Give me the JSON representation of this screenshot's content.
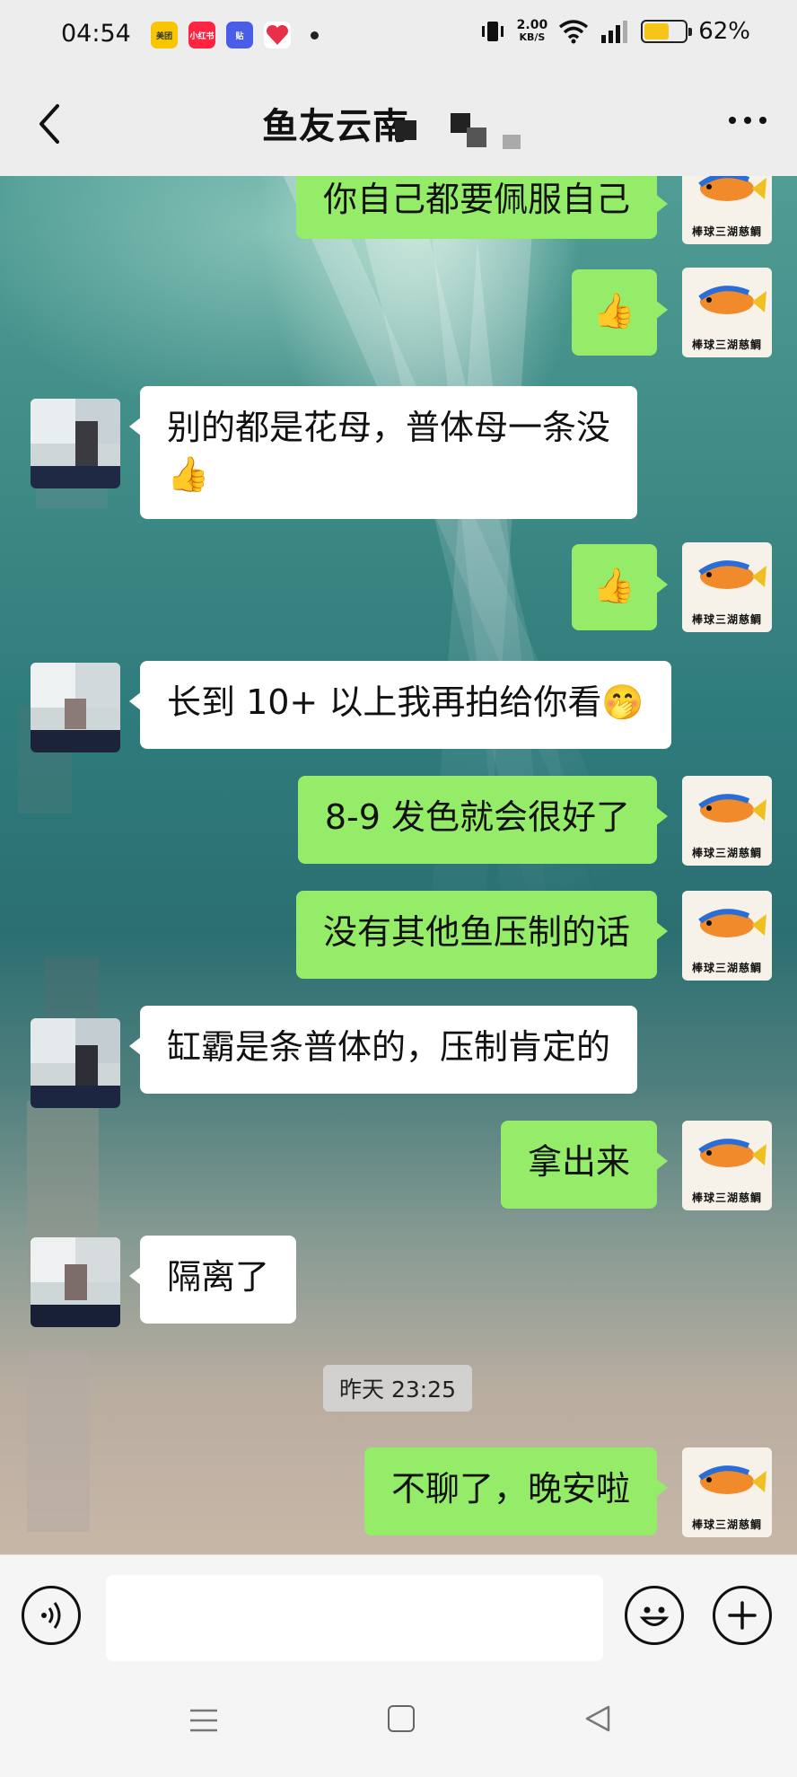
{
  "status_bar": {
    "time": "04:54",
    "apps": [
      {
        "icon": "meituan-icon",
        "label": "美团",
        "color": "#f7c600"
      },
      {
        "icon": "xiaohongshu-icon",
        "label": "小红书",
        "color": "#ff2442"
      },
      {
        "icon": "tieba-icon",
        "label": "贴",
        "color": "#4a5de8"
      },
      {
        "icon": "heart-app-icon",
        "label": "",
        "color": "#e8304a"
      }
    ],
    "network_speed_value": "2.00",
    "network_speed_unit": "KB/S",
    "battery_level": 0.62,
    "battery_percent": "62%"
  },
  "header": {
    "title": "鱼友云南"
  },
  "messages": [
    {
      "sender": "me",
      "text": "你自己都要佩服自己"
    },
    {
      "sender": "me",
      "text": "👍"
    },
    {
      "sender": "other",
      "text": "别的都是花母，普体母一条没",
      "line2": "👍"
    },
    {
      "sender": "me",
      "text": "👍"
    },
    {
      "sender": "other",
      "text": "长到 10+ 以上我再拍给你看🤭"
    },
    {
      "sender": "me",
      "text": "8-9 发色就会很好了"
    },
    {
      "sender": "me",
      "text": "没有其他鱼压制的话"
    },
    {
      "sender": "other",
      "text": "缸霸是条普体的，压制肯定的"
    },
    {
      "sender": "me",
      "text": "拿出来"
    },
    {
      "sender": "other",
      "text": "隔离了"
    },
    {
      "sender": "me",
      "text": "不聊了，晚安啦"
    }
  ],
  "timestamp_chip": "昨天 23:25",
  "my_avatar": {
    "caption": "棒球三湖慈鲷"
  },
  "input_bar": {
    "placeholder": ""
  }
}
